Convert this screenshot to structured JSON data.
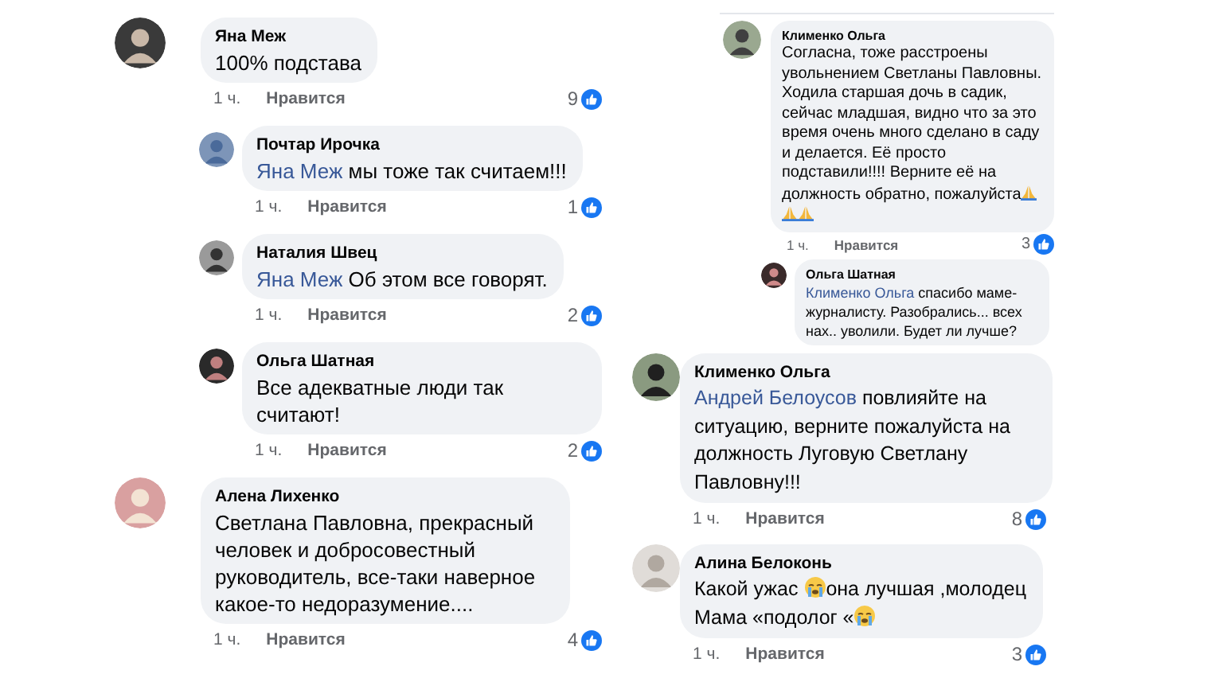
{
  "panels": [
    {
      "comments": [
        {
          "author": "Яна Меж",
          "reply": false,
          "parts": [
            {
              "kind": "text",
              "text": "100%  подстава"
            }
          ],
          "time": "1 ч.",
          "like": "Нравится",
          "likes": "9"
        },
        {
          "author": "Почтар Ирочка",
          "reply": true,
          "parts": [
            {
              "kind": "mention",
              "text": "Яна Меж"
            },
            {
              "kind": "text",
              "text": " мы тоже так считаем!!!"
            }
          ],
          "time": "1 ч.",
          "like": "Нравится",
          "likes": "1"
        },
        {
          "author": "Наталия Швец",
          "reply": true,
          "parts": [
            {
              "kind": "mention",
              "text": "Яна Меж"
            },
            {
              "kind": "text",
              "text": " Об этом все говорят."
            }
          ],
          "time": "1 ч.",
          "like": "Нравится",
          "likes": "2"
        },
        {
          "author": "Ольга Шатная",
          "reply": true,
          "parts": [
            {
              "kind": "text",
              "text": "Все адекватные люди так считают!"
            }
          ],
          "time": "1 ч.",
          "like": "Нравится",
          "likes": "2"
        },
        {
          "author": "Алена Лихенко",
          "reply": false,
          "parts": [
            {
              "kind": "text",
              "text": "Светлана Павловна, прекрасный человек и добросовестный руководитель, все-таки наверное какое-то недоразумение...."
            }
          ],
          "time": "1 ч.",
          "like": "Нравится",
          "likes": "4"
        }
      ]
    },
    {
      "comments": [
        {
          "author": "Клименко Ольга",
          "reply": false,
          "parts": [
            {
              "kind": "text",
              "text": "Согласна, тоже расстроены увольнением Светланы Павловны. Ходила старшая дочь в садик, сейчас младшая, видно что за это время очень много сделано в саду и делается. Её просто подставили!!!! Верните её на должность обратно, пожалуйста"
            },
            {
              "kind": "pray"
            },
            {
              "kind": "pray"
            },
            {
              "kind": "pray"
            }
          ],
          "time": "1 ч.",
          "like": "Нравится",
          "likes": "3"
        },
        {
          "author": "Ольга Шатная",
          "reply": true,
          "parts": [
            {
              "kind": "mention",
              "text": "Клименко Ольга"
            },
            {
              "kind": "text",
              "text": " спасибо маме-журналисту. Разобрались... всех нах.. уволили. Будет ли лучше?"
            }
          ]
        }
      ]
    },
    {
      "comments": [
        {
          "author": "Клименко Ольга",
          "reply": false,
          "parts": [
            {
              "kind": "mention",
              "text": "Андрей Белоусов"
            },
            {
              "kind": "text",
              "text": " повлияйте на ситуацию,  верните пожалуйста на должность Луговую Светлану Павловну!!!"
            }
          ],
          "time": "1 ч.",
          "like": "Нравится",
          "likes": "8"
        },
        {
          "author": "Алина Белоконь",
          "reply": false,
          "parts": [
            {
              "kind": "text",
              "text": "Какой ужас "
            },
            {
              "kind": "cry"
            },
            {
              "kind": "text",
              "text": "она лучшая ,молодец"
            },
            {
              "kind": "break"
            },
            {
              "kind": "text",
              "text": "Мама «подолог «"
            },
            {
              "kind": "cry"
            }
          ],
          "time": "1 ч.",
          "like": "Нравится",
          "likes": "3"
        }
      ]
    }
  ]
}
